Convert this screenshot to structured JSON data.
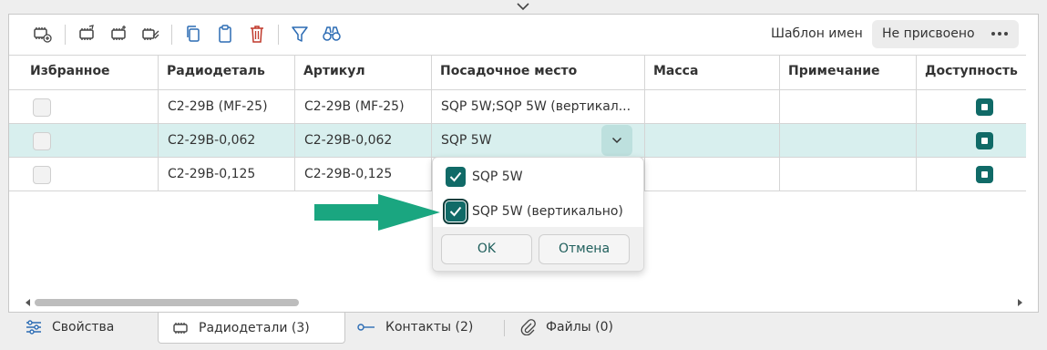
{
  "toolbar": {
    "icons": [
      "add-chip-icon",
      "chip-edit-icon",
      "chip-copy-icon",
      "chip-tag-icon",
      "copy-icon",
      "paste-icon",
      "delete-icon",
      "filter-icon",
      "binoculars-icon"
    ],
    "template_label": "Шаблон имен",
    "template_value": "Не присвоено"
  },
  "table": {
    "columns": [
      "Избранное",
      "Радиодеталь",
      "Артикул",
      "Посадочное место",
      "Масса",
      "Примечание",
      "Доступность"
    ],
    "rows": [
      {
        "favorite": false,
        "part": "C2-29B (MF-25)",
        "article": "C2-29B (MF-25)",
        "footprint": "SQP 5W;SQP 5W (вертикал...",
        "mass": "",
        "note": "",
        "available": true,
        "selected": false
      },
      {
        "favorite": false,
        "part": "C2-29B-0,062",
        "article": "C2-29B-0,062",
        "footprint": "SQP 5W",
        "mass": "",
        "note": "",
        "available": true,
        "selected": true
      },
      {
        "favorite": false,
        "part": "C2-29B-0,125",
        "article": "C2-29B-0,125",
        "footprint": "",
        "mass": "",
        "note": "",
        "available": true,
        "selected": false
      }
    ]
  },
  "dropdown": {
    "options": [
      {
        "label": "SQP 5W",
        "checked": true
      },
      {
        "label": "SQP 5W (вертикально)",
        "checked": true
      }
    ],
    "ok_label": "OK",
    "cancel_label": "Отмена"
  },
  "tabs": [
    {
      "label": "Свойства",
      "icon": "sliders-icon",
      "active": false
    },
    {
      "label": "Радиодетали (3)",
      "icon": "chip-icon",
      "active": true
    },
    {
      "label": "Контакты (2)",
      "icon": "pin-icon",
      "active": false
    },
    {
      "label": "Файлы (0)",
      "icon": "paperclip-icon",
      "active": false
    }
  ],
  "colors": {
    "accent": "#106a67",
    "selected_row": "#d8efee",
    "annotation_arrow": "#1aa680"
  }
}
